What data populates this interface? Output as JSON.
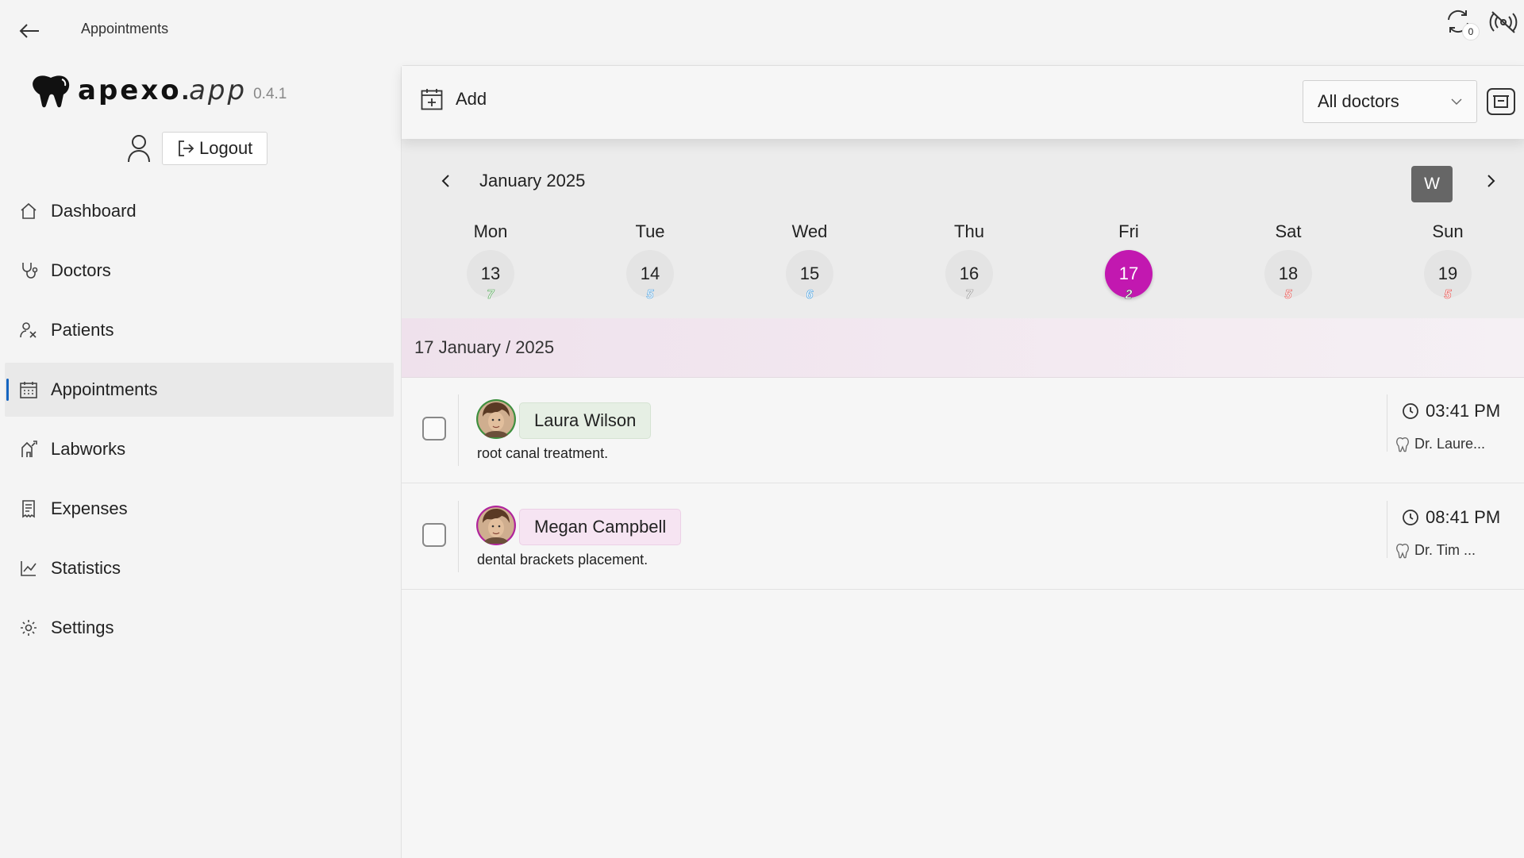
{
  "topbar": {
    "title": "Appointments",
    "sync_count": "0"
  },
  "brand": {
    "name": "apexo",
    "dot": ".",
    "suffix": "app",
    "version": "0.4.1"
  },
  "user": {
    "logout_label": "Logout"
  },
  "nav": [
    {
      "label": "Dashboard",
      "icon": "home-icon"
    },
    {
      "label": "Doctors",
      "icon": "stethoscope-icon"
    },
    {
      "label": "Patients",
      "icon": "patients-icon"
    },
    {
      "label": "Appointments",
      "icon": "calendar-icon",
      "active": true
    },
    {
      "label": "Labworks",
      "icon": "labworks-icon"
    },
    {
      "label": "Expenses",
      "icon": "receipt-icon"
    },
    {
      "label": "Statistics",
      "icon": "chart-icon"
    },
    {
      "label": "Settings",
      "icon": "gear-icon"
    }
  ],
  "toolbar": {
    "add_label": "Add",
    "doctor_filter": "All doctors"
  },
  "calendar": {
    "month_label": "January 2025",
    "view_label": "W",
    "selected_color": "#c218b0",
    "days": [
      {
        "name": "Mon",
        "date": "13",
        "count": "7",
        "count_color": "#43a047"
      },
      {
        "name": "Tue",
        "date": "14",
        "count": "5",
        "count_color": "#3d9be0"
      },
      {
        "name": "Wed",
        "date": "15",
        "count": "6",
        "count_color": "#3d9be0"
      },
      {
        "name": "Thu",
        "date": "16",
        "count": "7",
        "count_color": "#888888"
      },
      {
        "name": "Fri",
        "date": "17",
        "count": "2",
        "count_color": "#555555",
        "selected": true
      },
      {
        "name": "Sat",
        "date": "18",
        "count": "5",
        "count_color": "#e53935"
      },
      {
        "name": "Sun",
        "date": "19",
        "count": "5",
        "count_color": "#e53935"
      }
    ]
  },
  "date_banner": "17 January / 2025",
  "appointments": [
    {
      "patient": "Laura Wilson",
      "note": "root canal treatment.",
      "time": "03:41 PM",
      "doctor": "Dr. Laure...",
      "name_bg": "#e6efe4",
      "name_border": "#d5e3d2",
      "avatar_ring": "#3f8f3f"
    },
    {
      "patient": "Megan Campbell",
      "note": "dental brackets placement.",
      "time": "08:41 PM",
      "doctor": "Dr. Tim ...",
      "name_bg": "#f6e4f2",
      "name_border": "#ecd0e6",
      "avatar_ring": "#b0249c"
    }
  ]
}
